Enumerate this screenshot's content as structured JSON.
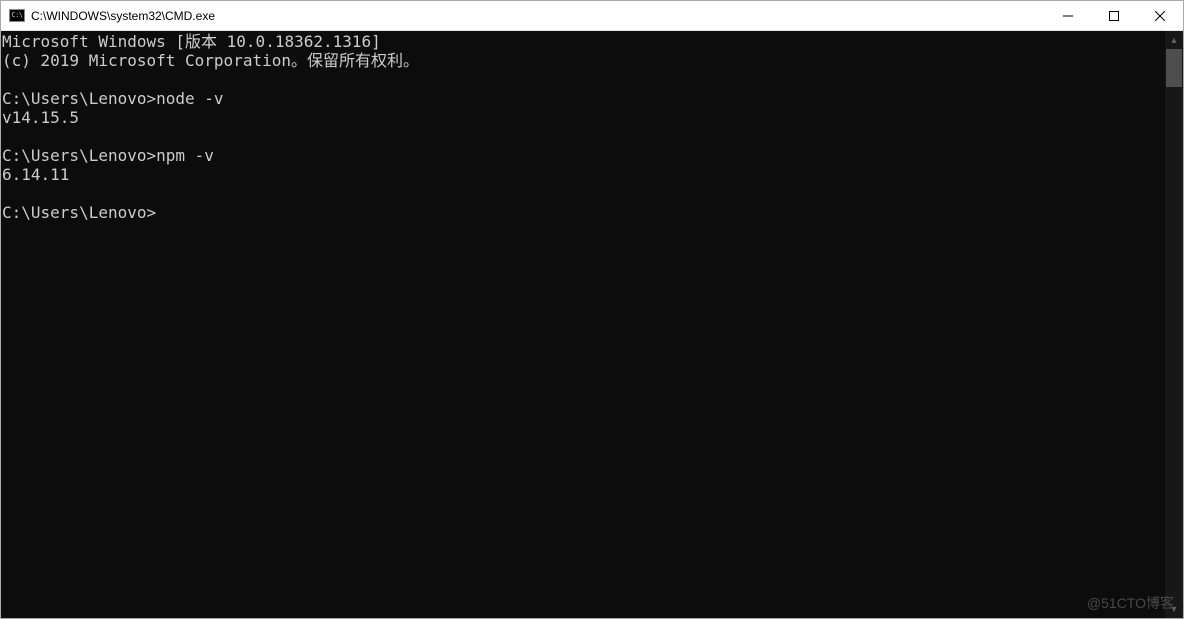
{
  "window": {
    "title": "C:\\WINDOWS\\system32\\CMD.exe",
    "icon_label": "cmd-icon"
  },
  "console": {
    "lines": [
      "Microsoft Windows [版本 10.0.18362.1316]",
      "(c) 2019 Microsoft Corporation。保留所有权利。",
      "",
      "C:\\Users\\Lenovo>node -v",
      "v14.15.5",
      "",
      "C:\\Users\\Lenovo>npm -v",
      "6.14.11",
      "",
      "C:\\Users\\Lenovo>"
    ]
  },
  "watermark": "@51CTO博客"
}
